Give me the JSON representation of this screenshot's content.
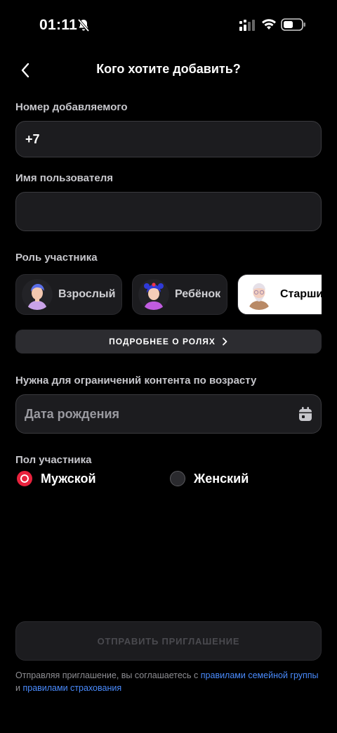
{
  "status_bar": {
    "time": "01:11"
  },
  "header": {
    "title": "Кого хотите добавить?"
  },
  "phone": {
    "label": "Номер добавляемого",
    "value": "+7"
  },
  "username": {
    "label": "Имя пользователя",
    "value": ""
  },
  "roles": {
    "label": "Роль участника",
    "items": [
      {
        "label": "Взрослый",
        "avatar": "adult-avatar"
      },
      {
        "label": "Ребёнок",
        "avatar": "child-avatar"
      },
      {
        "label": "Старший",
        "avatar": "senior-avatar"
      }
    ],
    "selected_index": 2,
    "more_label": "ПОДРОБНЕЕ О РОЛЯХ"
  },
  "birth_date": {
    "label": "Нужна для ограничений контента по возрасту",
    "placeholder": "Дата рождения"
  },
  "gender": {
    "label": "Пол участника",
    "options": [
      {
        "label": "Мужской",
        "selected": true
      },
      {
        "label": "Женский",
        "selected": false
      }
    ]
  },
  "submit": {
    "label": "ОТПРАВИТЬ ПРИГЛАШЕНИЕ",
    "enabled": false
  },
  "legal": {
    "prefix": "Отправляя приглашение, вы соглашаетесь с ",
    "link1": "правилами семейной группы",
    "middle": " и ",
    "link2": "правилами страхования"
  },
  "colors": {
    "accent_red": "#e8223d",
    "link_blue": "#4a8cff",
    "background": "#000000",
    "field_bg": "#1c1c1f"
  }
}
